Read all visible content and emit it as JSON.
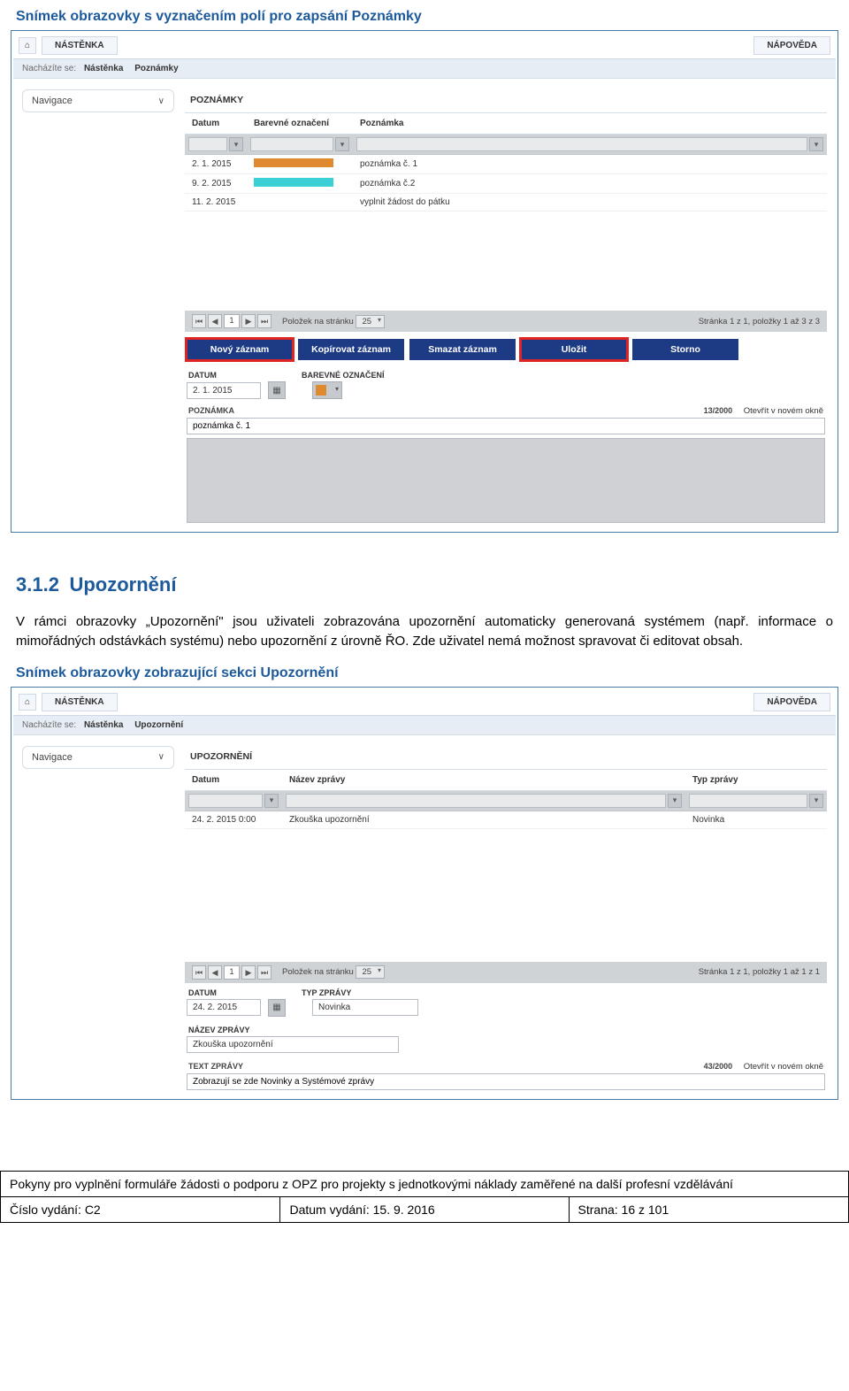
{
  "headings": {
    "caption1": "Snímek obrazovky s vyznačením polí pro zapsání Poznámky",
    "section_num": "3.1.2",
    "section_title": "Upozornění",
    "paragraph": "V rámci obrazovky „Upozornění\" jsou uživateli zobrazována upozornění automaticky generovaná systémem (např. informace o mimořádných odstávkách systému) nebo upozornění z úrovně ŘO. Zde uživatel nemá možnost spravovat či editovat obsah.",
    "caption2": "Snímek obrazovky zobrazující sekci Upozornění"
  },
  "topbar": {
    "home_glyph": "⌂",
    "nastenka": "NÁSTĚNKA",
    "napoveda": "NÁPOVĚDA"
  },
  "crumbs1": {
    "label": "Nacházíte se:",
    "a": "Nástěnka",
    "b": "Poznámky"
  },
  "crumbs2": {
    "label": "Nacházíte se:",
    "a": "Nástěnka",
    "b": "Upozornění"
  },
  "sidebar": {
    "nav_label": "Navigace"
  },
  "notes_panel": {
    "title": "POZNÁMKY",
    "cols": {
      "datum": "Datum",
      "barva": "Barevné označení",
      "pozn": "Poznámka"
    },
    "rows": [
      {
        "datum": "2. 1. 2015",
        "color": "orange",
        "pozn": "poznámka č. 1"
      },
      {
        "datum": "9. 2. 2015",
        "color": "cyan",
        "pozn": "poznámka č.2"
      },
      {
        "datum": "11. 2. 2015",
        "color": "",
        "pozn": "vyplnit žádost do pátku"
      }
    ],
    "pager": {
      "per_label": "Položek na stránku",
      "per_val": "25",
      "status": "Stránka 1 z 1, položky 1 až 3 z 3"
    },
    "actions": {
      "novy": "Nový záznam",
      "kopirovat": "Kopírovat záznam",
      "smazat": "Smazat záznam",
      "ulozit": "Uložit",
      "storno": "Storno"
    },
    "form": {
      "datum_label": "DATUM",
      "datum_val": "2. 1. 2015",
      "barva_label": "BAREVNÉ OZNAČENÍ",
      "pozn_label": "POZNÁMKA",
      "counter": "13/2000",
      "open_new": "Otevřít v novém okně",
      "pozn_val": "poznámka č. 1"
    }
  },
  "alerts_panel": {
    "title": "UPOZORNĚNÍ",
    "cols": {
      "datum": "Datum",
      "nazev": "Název zprávy",
      "typ": "Typ zprávy"
    },
    "rows": [
      {
        "datum": "24. 2. 2015 0:00",
        "nazev": "Zkouška upozornění",
        "typ": "Novinka"
      }
    ],
    "pager": {
      "per_label": "Položek na stránku",
      "per_val": "25",
      "status": "Stránka 1 z 1, položky 1 až 1 z 1"
    },
    "form": {
      "datum_label": "DATUM",
      "datum_val": "24. 2. 2015",
      "typ_label": "TYP ZPRÁVY",
      "typ_val": "Novinka",
      "nazev_label": "NÁZEV ZPRÁVY",
      "nazev_val": "Zkouška upozornění",
      "text_label": "TEXT ZPRÁVY",
      "counter": "43/2000",
      "open_new": "Otevřít v novém okně",
      "text_val": "Zobrazují se zde Novinky a Systémové zprávy"
    }
  },
  "footer": {
    "long": "Pokyny pro vyplnění formuláře žádosti o podporu z OPZ pro projekty s jednotkovými náklady zaměřené na další profesní vzdělávání",
    "issue": "Číslo vydání: C2",
    "date": "Datum vydání: 15. 9. 2016",
    "page": "Strana: 16 z 101"
  }
}
